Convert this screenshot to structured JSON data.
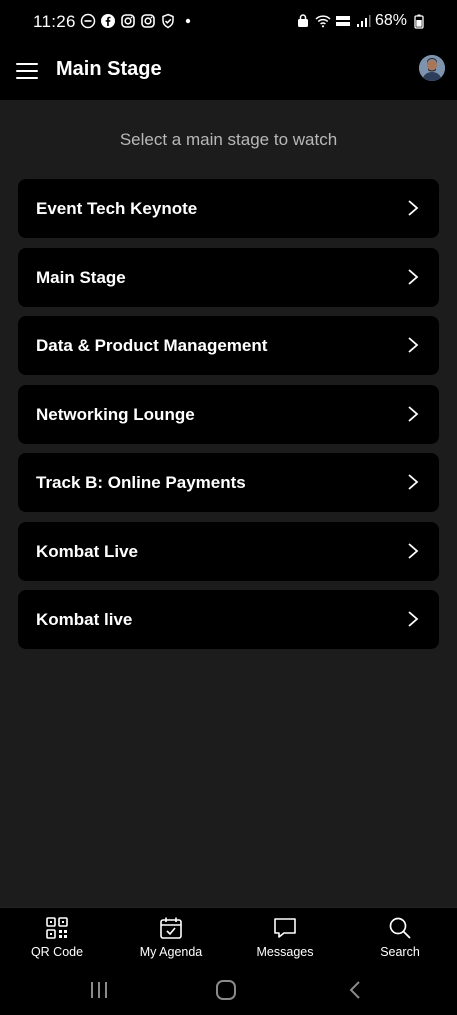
{
  "status_bar": {
    "time": "11:26",
    "battery_percent": "68%"
  },
  "header": {
    "title": "Main Stage"
  },
  "subtitle": "Select a main stage to watch",
  "stages": [
    {
      "label": "Event Tech Keynote"
    },
    {
      "label": "Main Stage"
    },
    {
      "label": "Data & Product Management"
    },
    {
      "label": "Networking Lounge"
    },
    {
      "label": "Track B: Online Payments"
    },
    {
      "label": "Kombat Live"
    },
    {
      "label": "Kombat live"
    }
  ],
  "bottom_nav": [
    {
      "label": "QR Code",
      "icon": "qr-code-icon"
    },
    {
      "label": "My Agenda",
      "icon": "calendar-check-icon"
    },
    {
      "label": "Messages",
      "icon": "chat-bubble-icon"
    },
    {
      "label": "Search",
      "icon": "search-icon"
    }
  ],
  "colors": {
    "background": "#1c1c1c",
    "surface": "#000000",
    "text": "#ffffff",
    "muted_text": "#b8b8b8"
  }
}
